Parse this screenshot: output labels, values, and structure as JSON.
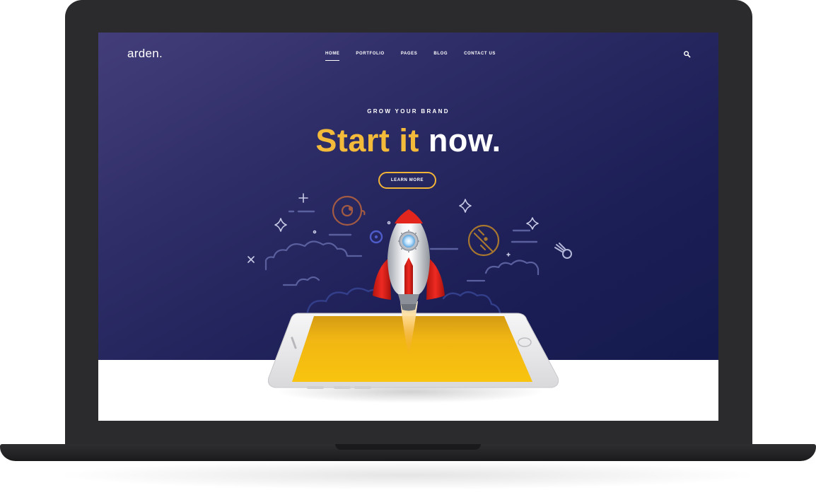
{
  "site": {
    "logo": "arden."
  },
  "nav": {
    "items": [
      {
        "label": "HOME",
        "active": true
      },
      {
        "label": "PORTFOLIO",
        "active": false
      },
      {
        "label": "PAGES",
        "active": false
      },
      {
        "label": "BLOG",
        "active": false
      },
      {
        "label": "CONTACT US",
        "active": false
      }
    ],
    "search_icon": "search-icon"
  },
  "hero": {
    "eyebrow": "GROW YOUR BRAND",
    "headline_accent": "Start it",
    "headline_rest": "now.",
    "cta_label": "LEARN MORE"
  },
  "colors": {
    "hero_gradient_start": "#433e7a",
    "hero_gradient_end": "#141a4d",
    "accent_yellow": "#f4bb3b",
    "button_border": "#f2b437",
    "rocket_red": "#d9231c",
    "phone_screen": "#f6bb12",
    "laptop_body": "#2b2b2d"
  },
  "illustration": {
    "icons": [
      "rocket-icon",
      "phone-icon",
      "planet-icon",
      "eye-planet-icon",
      "comet-icon",
      "sparkle-icon",
      "cloud-icon"
    ]
  }
}
